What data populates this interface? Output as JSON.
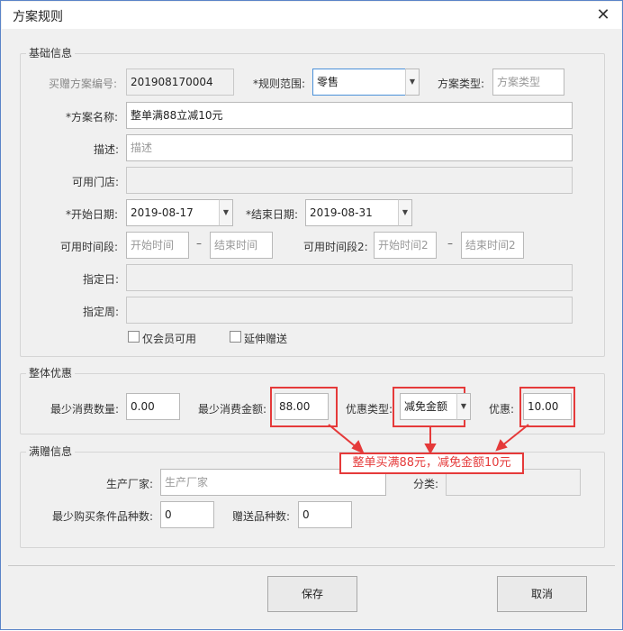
{
  "window": {
    "title": "方案规则",
    "close_glyph": "✕"
  },
  "basic": {
    "group_title": "基础信息",
    "code_label": "买赠方案编号:",
    "code_value": "201908170004",
    "scope_label": "*规则范围:",
    "scope_value": "零售",
    "type_label": "方案类型:",
    "type_placeholder": "方案类型",
    "name_label": "*方案名称:",
    "name_value": "整单满88立减10元",
    "desc_label": "描述:",
    "desc_placeholder": "描述",
    "stores_label": "可用门店:",
    "stores_value": "",
    "start_label": "*开始日期:",
    "start_value": "2019-08-17",
    "end_label": "*结束日期:",
    "end_value": "2019-08-31",
    "time1_label": "可用时间段:",
    "time1_start_ph": "开始时间",
    "time1_end_ph": "结束时间",
    "time2_label": "可用时间段2:",
    "time2_start_ph": "开始时间2",
    "time2_end_ph": "结束时间2",
    "range_dash": "–",
    "day_label": "指定日:",
    "day_value": "",
    "week_label": "指定周:",
    "week_value": "",
    "member_only_label": "仅会员可用",
    "member_only_checked": false,
    "extend_label": "延伸赠送",
    "extend_checked": false
  },
  "overall": {
    "group_title": "整体优惠",
    "min_qty_label": "最少消费数量:",
    "min_qty_value": "0.00",
    "min_amount_label": "最少消费金额:",
    "min_amount_value": "88.00",
    "discount_type_label": "优惠类型:",
    "discount_type_value": "减免金额",
    "discount_label": "优惠:",
    "discount_value": "10.00"
  },
  "gift": {
    "group_title": "满赠信息",
    "maker_label": "生产厂家:",
    "maker_placeholder": "生产厂家",
    "category_label": "分类:",
    "category_value": "",
    "min_kinds_label": "最少购买条件品种数:",
    "min_kinds_value": "0",
    "gift_kinds_label": "赠送品种数:",
    "gift_kinds_value": "0"
  },
  "annotation": {
    "text": "整单买满88元，减免金额10元",
    "color": "#e53a3a"
  },
  "footer": {
    "save_label": "保存",
    "cancel_label": "取消"
  },
  "icons": {
    "dropdown": "▼",
    "close": "close-icon"
  }
}
